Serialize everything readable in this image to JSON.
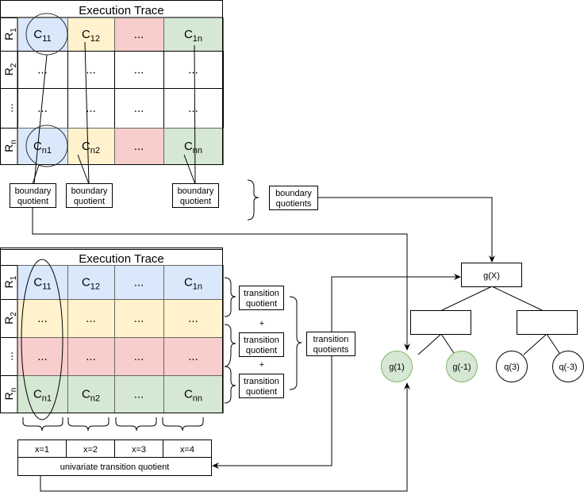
{
  "colors": {
    "blue": "#dae8fc",
    "yellow": "#fff2cc",
    "red": "#f8cecc",
    "green": "#d5e8d4",
    "green_stroke": "#82b366"
  },
  "top_trace": {
    "title": "Execution Trace",
    "rows": [
      {
        "label": "R",
        "sub": "1",
        "cells": [
          {
            "t": "C",
            "s": "11"
          },
          {
            "t": "C",
            "s": "12"
          },
          {
            "t": "...",
            "s": ""
          },
          {
            "t": "C",
            "s": "1n"
          }
        ]
      },
      {
        "label": "R",
        "sub": "2",
        "cells": [
          {
            "t": "...",
            "s": ""
          },
          {
            "t": "...",
            "s": ""
          },
          {
            "t": "...",
            "s": ""
          },
          {
            "t": "...",
            "s": ""
          }
        ]
      },
      {
        "label": "...",
        "sub": "",
        "cells": [
          {
            "t": "...",
            "s": ""
          },
          {
            "t": "...",
            "s": ""
          },
          {
            "t": "...",
            "s": ""
          },
          {
            "t": "...",
            "s": ""
          }
        ]
      },
      {
        "label": "R",
        "sub": "n",
        "cells": [
          {
            "t": "C",
            "s": "n1"
          },
          {
            "t": "C",
            "s": "n2"
          },
          {
            "t": "...",
            "s": ""
          },
          {
            "t": "C",
            "s": "nn"
          }
        ]
      }
    ],
    "boundary_boxes": [
      [
        "boundary",
        "quotient"
      ],
      [
        "boundary",
        "quotient"
      ],
      [
        "boundary",
        "quotient"
      ]
    ],
    "boundary_group": [
      "boundary",
      "quotients"
    ]
  },
  "bottom_trace": {
    "title": "Execution Trace",
    "rows": [
      {
        "label": "R",
        "sub": "1",
        "cells": [
          {
            "t": "C",
            "s": "11"
          },
          {
            "t": "C",
            "s": "12"
          },
          {
            "t": "...",
            "s": ""
          },
          {
            "t": "C",
            "s": "1n"
          }
        ]
      },
      {
        "label": "R",
        "sub": "2",
        "cells": [
          {
            "t": "...",
            "s": ""
          },
          {
            "t": "...",
            "s": ""
          },
          {
            "t": "...",
            "s": ""
          },
          {
            "t": "...",
            "s": ""
          }
        ]
      },
      {
        "label": "...",
        "sub": "",
        "cells": [
          {
            "t": "...",
            "s": ""
          },
          {
            "t": "...",
            "s": ""
          },
          {
            "t": "...",
            "s": ""
          },
          {
            "t": "...",
            "s": ""
          }
        ]
      },
      {
        "label": "R",
        "sub": "n",
        "cells": [
          {
            "t": "C",
            "s": "n1"
          },
          {
            "t": "C",
            "s": "n2"
          },
          {
            "t": "...",
            "s": ""
          },
          {
            "t": "C",
            "s": "nn"
          }
        ]
      }
    ],
    "transition_boxes": [
      [
        "transition",
        "quotient"
      ],
      [
        "transition",
        "quotient"
      ],
      [
        "transition",
        "quotient"
      ]
    ],
    "plus": "+",
    "transition_group": [
      "transition",
      "quotients"
    ],
    "x_labels": [
      "x=1",
      "x=2",
      "x=3",
      "x=4"
    ],
    "univariate": "univariate transition quotient"
  },
  "tree": {
    "root": "g(X)",
    "leaves": [
      "g(1)",
      "g(-1)",
      "q(3)",
      "q(-3)"
    ]
  }
}
